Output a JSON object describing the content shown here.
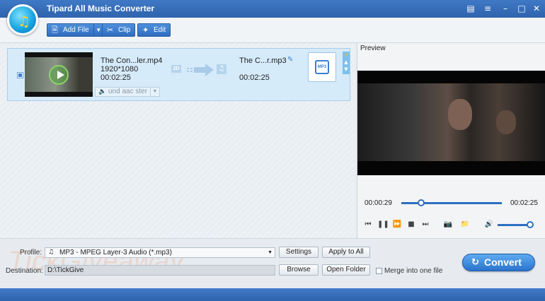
{
  "window": {
    "title": "Tipard All Music Converter",
    "controls": [
      "feedback-icon",
      "menu-icon",
      "minimize-icon",
      "maximize-icon",
      "close-icon"
    ]
  },
  "toolbar": {
    "add_file_label": "Add File",
    "clip_label": "Clip",
    "edit_label": "Edit"
  },
  "file_item": {
    "checked": true,
    "source_name": "The Con...ler.mp4",
    "source_resolution": "1920*1080",
    "source_duration": "00:02:25",
    "audio_track": "und aac ster",
    "badge_2d": "2D",
    "output_name": "The C...r.mp3",
    "output_duration": "00:02:25"
  },
  "preview": {
    "label": "Preview",
    "current_time": "00:00:29",
    "total_time": "00:02:25",
    "seek_fraction": 0.2,
    "volume_fraction": 0.95
  },
  "bottom": {
    "profile_label": "Profile:",
    "profile_value": "MP3 - MPEG Layer-3 Audio (*.mp3)",
    "settings_label": "Settings",
    "apply_to_all_label": "Apply to All",
    "destination_label": "Destination:",
    "destination_value": "D:\\TickGive",
    "browse_label": "Browse",
    "open_folder_label": "Open Folder",
    "merge_label": "Merge into one file",
    "convert_label": "Convert"
  },
  "watermark": "TickGiveaway",
  "colors": {
    "titlebar": "#3269b6",
    "accent": "#2f6ec0",
    "selected_row": "#d6ebfa"
  }
}
